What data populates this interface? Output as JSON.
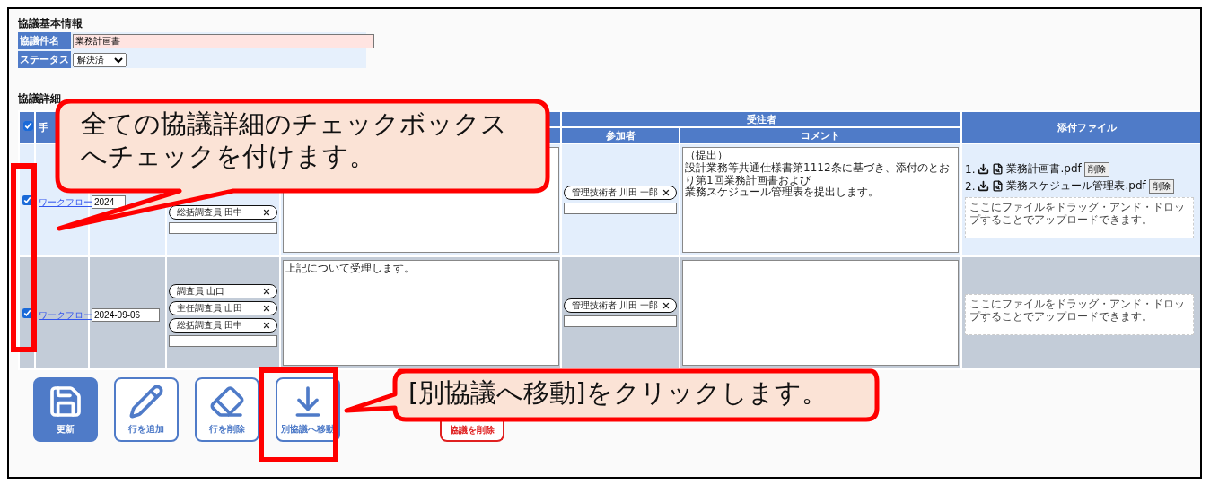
{
  "basic_info": {
    "heading": "協議基本情報",
    "fields": [
      {
        "label": "協議件名",
        "kind": "text",
        "value": "業務計画書"
      },
      {
        "label": "ステータス",
        "kind": "select",
        "value": "解決済"
      }
    ]
  },
  "details": {
    "heading": "協議詳細",
    "select_all_checked": true,
    "header": {
      "column_2": "手",
      "contractor_group": "受注者",
      "contractor_columns": [
        "参加者",
        "コメント"
      ],
      "attachments": "添付ファイル"
    },
    "rows": [
      {
        "checked": true,
        "link": "ワークフロー",
        "date": "2024",
        "participants": [
          "総括調査員 田中"
        ],
        "comment": "",
        "contractor_participants": [
          "管理技術者 川田 一郎"
        ],
        "contractor_comment": [
          "（提出）",
          "設計業務等共通仕様書第1112条に基づき、添付のとおり第1回業務計画書および",
          "業務スケジュール管理表を提出します。"
        ],
        "files": [
          {
            "number": "1.",
            "name": "業務計画書.pdf",
            "delete": "削除"
          },
          {
            "number": "2.",
            "name": "業務スケジュール管理表.pdf",
            "delete": "削除"
          }
        ],
        "dropzone": "ここにファイルをドラッグ・アンド・ドロップすることでアップロードできます。"
      },
      {
        "checked": true,
        "link": "ワークフロー",
        "date": "2024-09-06",
        "participants": [
          "調査員 山口",
          "主任調査員 山田",
          "総括調査員 田中"
        ],
        "comment": "上記について受理します。",
        "contractor_participants": [
          "管理技術者 川田 一郎"
        ],
        "contractor_comment": [],
        "files": [],
        "dropzone": "ここにファイルをドラッグ・アンド・ドロップすることでアップロードできます。"
      }
    ]
  },
  "actions": [
    {
      "kind": "save",
      "label": "更新"
    },
    {
      "kind": "add",
      "label": "行を追加"
    },
    {
      "kind": "remove",
      "label": "行を削除"
    },
    {
      "kind": "move",
      "label": "別協議へ移動"
    },
    {
      "kind": "delete",
      "label": "協議を削除"
    }
  ],
  "annotations": [
    {
      "kind": "checkboxes",
      "lines": [
        "全ての協議詳細のチェックボックス",
        "へチェックを付けます。"
      ]
    },
    {
      "kind": "move",
      "lines": [
        "[別協議へ移動]をクリックします。"
      ]
    }
  ]
}
